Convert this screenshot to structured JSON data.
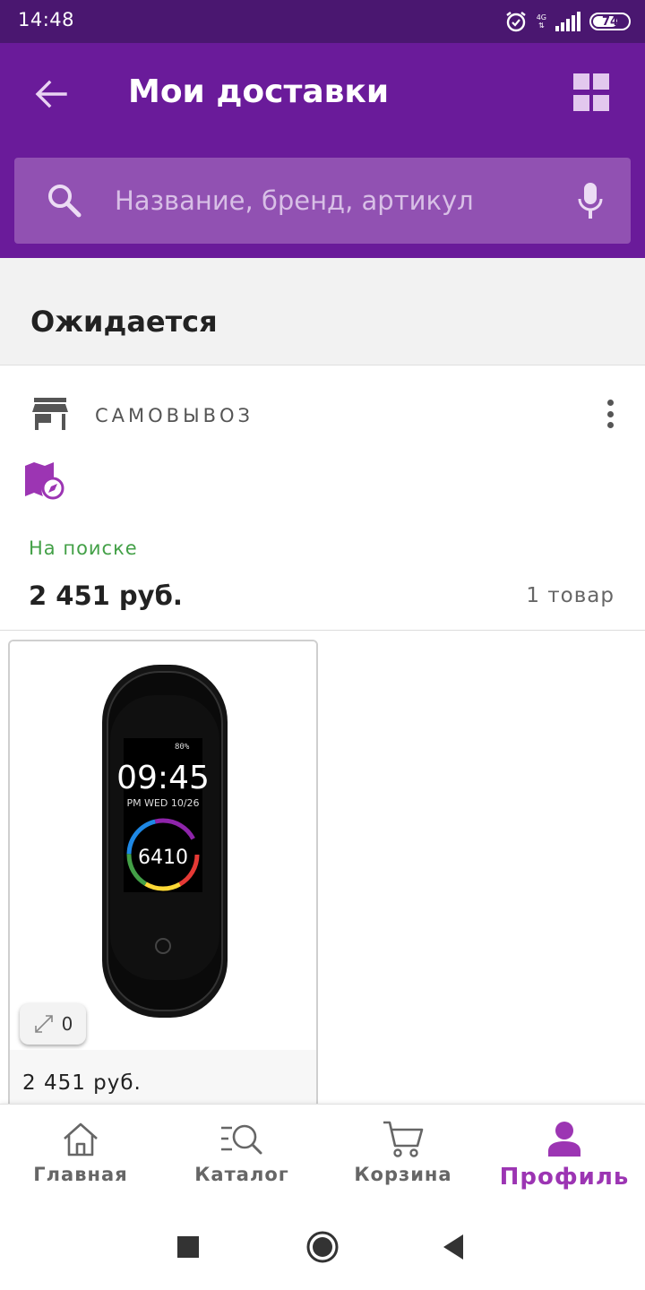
{
  "status_bar": {
    "time": "14:48",
    "network": "4G",
    "battery": "74",
    "battery_level": 0.74
  },
  "header": {
    "title": "Мои доставки",
    "search": {
      "placeholder": "Название, бренд, артикул",
      "value": ""
    }
  },
  "section": {
    "title": "Ожидается"
  },
  "order": {
    "delivery_type": "САМОВЫВОЗ",
    "status": "На поиске",
    "total": "2 451 руб.",
    "item_count": "1 товар",
    "status_color": "#43a047"
  },
  "product": {
    "price": "2 451 руб.",
    "zoom_count": "0",
    "image": {
      "time": "09:45",
      "date": "PM WED 10/26",
      "steps": "6410",
      "battery": "80%"
    }
  },
  "bottom_nav": {
    "items": [
      {
        "label": "Главная",
        "icon": "home-icon",
        "active": false
      },
      {
        "label": "Каталог",
        "icon": "catalog-search-icon",
        "active": false
      },
      {
        "label": "Корзина",
        "icon": "cart-icon",
        "active": false
      },
      {
        "label": "Профиль",
        "icon": "profile-icon",
        "active": true
      }
    ]
  },
  "colors": {
    "status_bar": "#4a1770",
    "header": "#6a1b9a",
    "search_bar": "#9151b2",
    "accent": "#9c35b3",
    "status_green": "#43a047"
  }
}
